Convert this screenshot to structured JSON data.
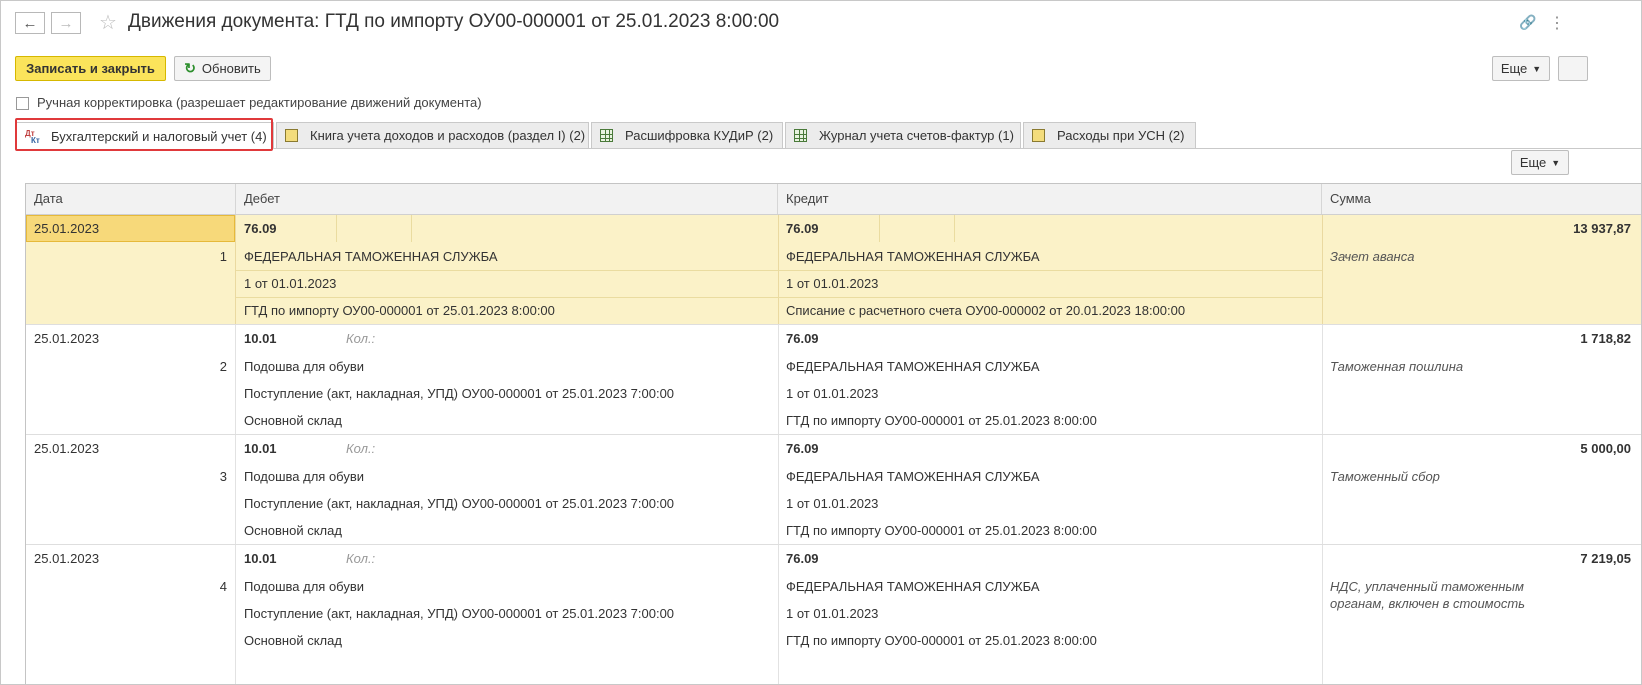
{
  "window": {
    "title": "Движения документа: ГТД по импорту ОУ00-000001 от 25.01.2023 8:00:00",
    "back_icon": "←",
    "forward_icon": "→",
    "star_icon": "☆",
    "link_icon": "🔗",
    "more_icon": "⋮"
  },
  "toolbar": {
    "save_close_label": "Записать и закрыть",
    "refresh_label": "Обновить",
    "more_label": "Еще"
  },
  "manual_edit": {
    "label": "Ручная корректировка (разрешает редактирование движений документа)"
  },
  "tabs": [
    {
      "label": "Бухгалтерский и налоговый учет (4)",
      "icon": "dt-kt-icon",
      "icon_dt": "Дт",
      "icon_kt": "Кт"
    },
    {
      "label": "Книга учета доходов и расходов (раздел I) (2)",
      "icon": "book-icon"
    },
    {
      "label": "Расшифровка КУДиР (2)",
      "icon": "table-icon"
    },
    {
      "label": "Журнал учета счетов-фактур (1)",
      "icon": "table-icon"
    },
    {
      "label": "Расходы при УСН (2)",
      "icon": "book-icon"
    }
  ],
  "grid": {
    "more_label": "Еще",
    "columns": [
      "Дата",
      "Дебет",
      "Кредит",
      "Сумма"
    ],
    "rows": [
      {
        "date": "25.01.2023",
        "n": "1",
        "debit": {
          "account": "76.09",
          "qty": "",
          "sub1": "ФЕДЕРАЛЬНАЯ ТАМОЖЕННАЯ СЛУЖБА",
          "sub2": "1 от 01.01.2023",
          "sub3": "ГТД по импорту ОУ00-000001 от 25.01.2023 8:00:00"
        },
        "credit": {
          "account": "76.09",
          "sub1": "ФЕДЕРАЛЬНАЯ ТАМОЖЕННАЯ СЛУЖБА",
          "sub2": "1 от 01.01.2023",
          "sub3": "Списание с расчетного счета ОУ00-000002 от 20.01.2023 18:00:00"
        },
        "amount": "13 937,87",
        "content": "Зачет аванса",
        "content2": ""
      },
      {
        "date": "25.01.2023",
        "n": "2",
        "debit": {
          "account": "10.01",
          "qty": "Кол.:",
          "sub1": "Подошва для обуви",
          "sub2": "Поступление (акт, накладная, УПД) ОУ00-000001 от 25.01.2023 7:00:00",
          "sub3": "Основной склад"
        },
        "credit": {
          "account": "76.09",
          "sub1": "ФЕДЕРАЛЬНАЯ ТАМОЖЕННАЯ СЛУЖБА",
          "sub2": "1 от 01.01.2023",
          "sub3": "ГТД по импорту ОУ00-000001 от 25.01.2023 8:00:00"
        },
        "amount": "1 718,82",
        "content": "Таможенная пошлина",
        "content2": ""
      },
      {
        "date": "25.01.2023",
        "n": "3",
        "debit": {
          "account": "10.01",
          "qty": "Кол.:",
          "sub1": "Подошва для обуви",
          "sub2": "Поступление (акт, накладная, УПД) ОУ00-000001 от 25.01.2023 7:00:00",
          "sub3": "Основной склад"
        },
        "credit": {
          "account": "76.09",
          "sub1": "ФЕДЕРАЛЬНАЯ ТАМОЖЕННАЯ СЛУЖБА",
          "sub2": "1 от 01.01.2023",
          "sub3": "ГТД по импорту ОУ00-000001 от 25.01.2023 8:00:00"
        },
        "amount": "5 000,00",
        "content": "Таможенный сбор",
        "content2": ""
      },
      {
        "date": "25.01.2023",
        "n": "4",
        "debit": {
          "account": "10.01",
          "qty": "Кол.:",
          "sub1": "Подошва для обуви",
          "sub2": "Поступление (акт, накладная, УПД) ОУ00-000001 от 25.01.2023 7:00:00",
          "sub3": "Основной склад"
        },
        "credit": {
          "account": "76.09",
          "sub1": "ФЕДЕРАЛЬНАЯ ТАМОЖЕННАЯ СЛУЖБА",
          "sub2": "1 от 01.01.2023",
          "sub3": "ГТД по импорту ОУ00-000001 от 25.01.2023 8:00:00"
        },
        "amount": "7 219,05",
        "content": "НДС, уплаченный таможенным",
        "content2": "органам, включен в стоимость"
      }
    ]
  }
}
